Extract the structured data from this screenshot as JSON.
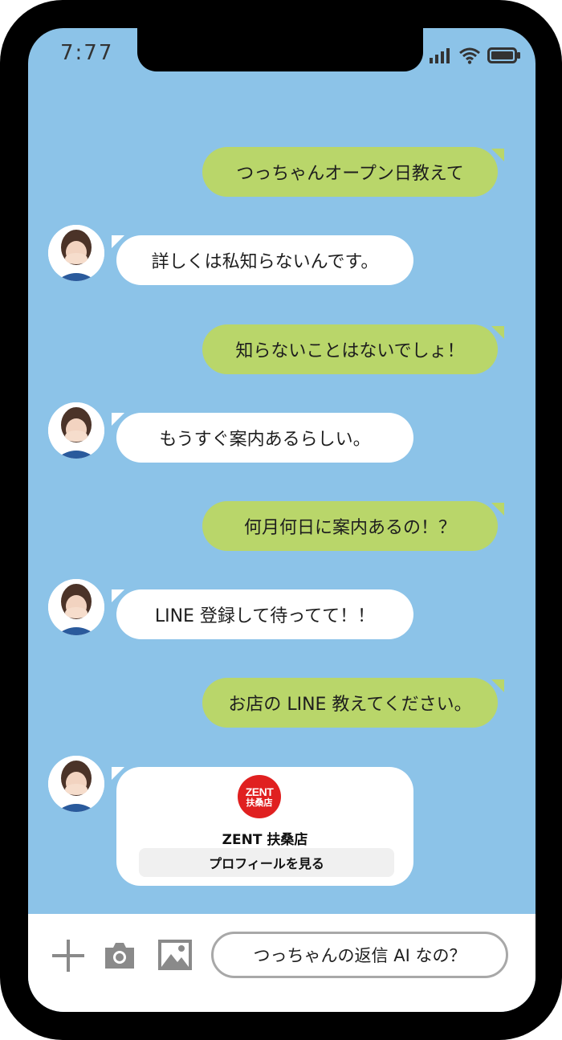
{
  "status_bar": {
    "time": "7:77",
    "icons": [
      "signal-icon",
      "wifi-icon",
      "battery-icon"
    ]
  },
  "messages": [
    {
      "from": "user",
      "text": "つっちゃんオープン日教えて"
    },
    {
      "from": "bot",
      "text": "詳しくは私知らないんです。"
    },
    {
      "from": "user",
      "text": "知らないことはないでしょ！"
    },
    {
      "from": "bot",
      "text": "もうすぐ案内あるらしい。"
    },
    {
      "from": "user",
      "text": "何月何日に案内あるの！？"
    },
    {
      "from": "bot",
      "text": "LINE 登録して待ってて！！"
    },
    {
      "from": "user",
      "text": "お店の LINE 教えてください。"
    }
  ],
  "profile_card": {
    "logo_line1": "ZENT",
    "logo_line2": "扶桑店",
    "name": "ZENT 扶桑店",
    "button_label": "プロフィールを見る"
  },
  "input_bar": {
    "icons": [
      "plus-icon",
      "camera-icon",
      "image-icon"
    ],
    "text": "つっちゃんの返信 AI なの？"
  },
  "colors": {
    "screen_bg": "#8cc3e8",
    "user_bubble": "#b9d66a",
    "bot_bubble": "#ffffff",
    "logo_red": "#e02020"
  }
}
